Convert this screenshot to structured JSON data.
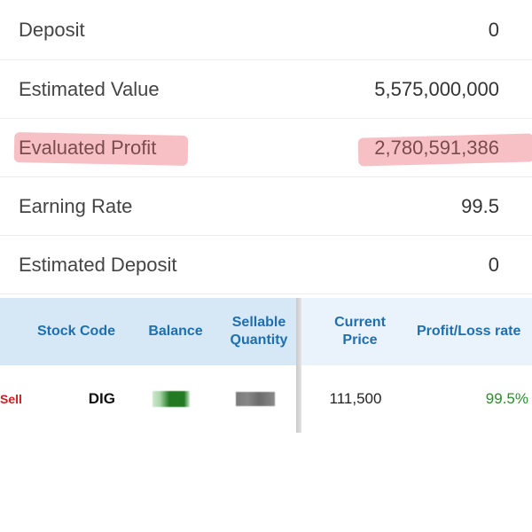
{
  "summary": {
    "rows": [
      {
        "label": "Deposit",
        "value": "0"
      },
      {
        "label": "Estimated Value",
        "value": "5,575,000,000"
      },
      {
        "label": "Evaluated Profit",
        "value": "2,780,591,386"
      },
      {
        "label": "Earning Rate",
        "value": "99.5"
      },
      {
        "label": "Estimated Deposit",
        "value": "0"
      }
    ]
  },
  "holdings": {
    "columns": {
      "stock_code": "Stock Code",
      "balance": "Balance",
      "sellable_quantity": "Sellable\nQuantity",
      "current_price": "Current\nPrice",
      "profit_loss_rate": "Profit/Loss rate"
    },
    "rows": [
      {
        "action": "Sell",
        "stock_code": "DIG",
        "current_price": "111,500",
        "profit_loss_rate": "99.5%"
      }
    ]
  },
  "colors": {
    "header_text": "#1e6fb0",
    "header_bg": "#d6e8f6",
    "sell": "#cc2020",
    "profit": "#2e8b2e",
    "highlight": "#f08c96"
  }
}
